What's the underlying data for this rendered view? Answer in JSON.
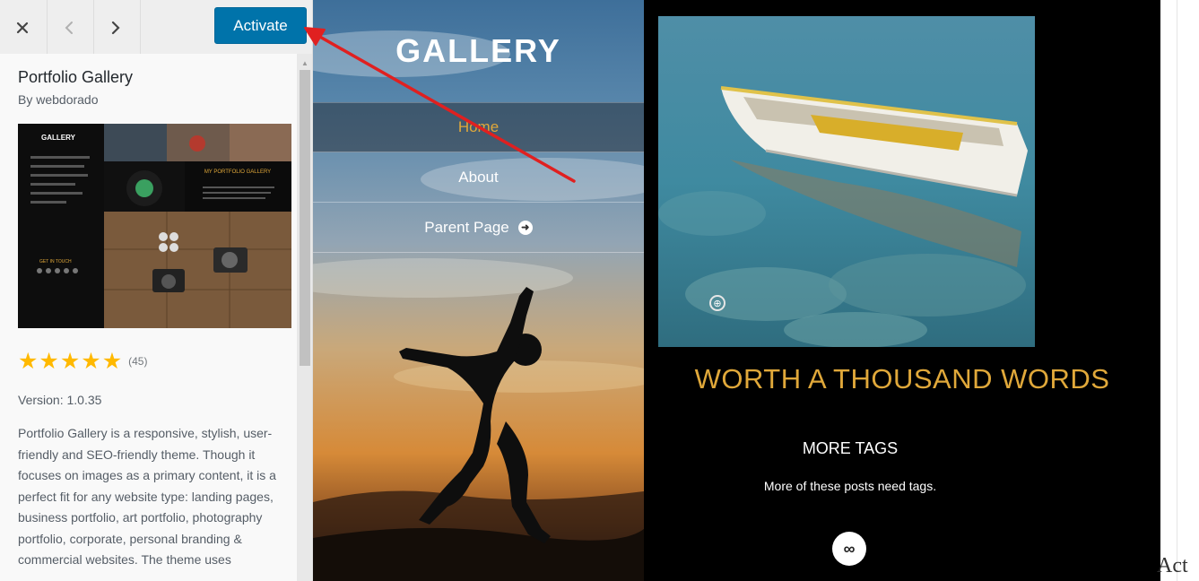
{
  "toolbar": {
    "close_icon": "×",
    "prev_icon": "‹",
    "next_icon": "›",
    "activate_label": "Activate"
  },
  "theme": {
    "name": "Portfolio Gallery",
    "author": "By webdorado",
    "rating_stars": 5,
    "rating_count": "(45)",
    "version": "Version: 1.0.35",
    "description": "Portfolio Gallery is a responsive, stylish, user-friendly and SEO-friendly theme. Though it focuses on images as a primary content, it is a perfect fit for any website type: landing pages, business portfolio, art portfolio, photography portfolio, corporate, personal branding & commercial websites. The theme uses"
  },
  "thumbnail": {
    "logo": "GALLERY",
    "heading": "MY PORTFOLIO GALLERY",
    "footer": "GET IN TOUCH"
  },
  "preview": {
    "logo": "GALLERY",
    "nav": [
      "Home",
      "About",
      "Parent Page"
    ],
    "heading": "WORTH A THOUSAND WORDS",
    "tags_title": "MORE TAGS",
    "tags_text": "More of these posts need tags.",
    "link_icon": "link-icon"
  },
  "right_strip_text": "Act",
  "colors": {
    "activate": "#0073aa",
    "accent_gold": "#e0a83a",
    "star": "#ffb900",
    "annotation_arrow": "#e02020"
  }
}
